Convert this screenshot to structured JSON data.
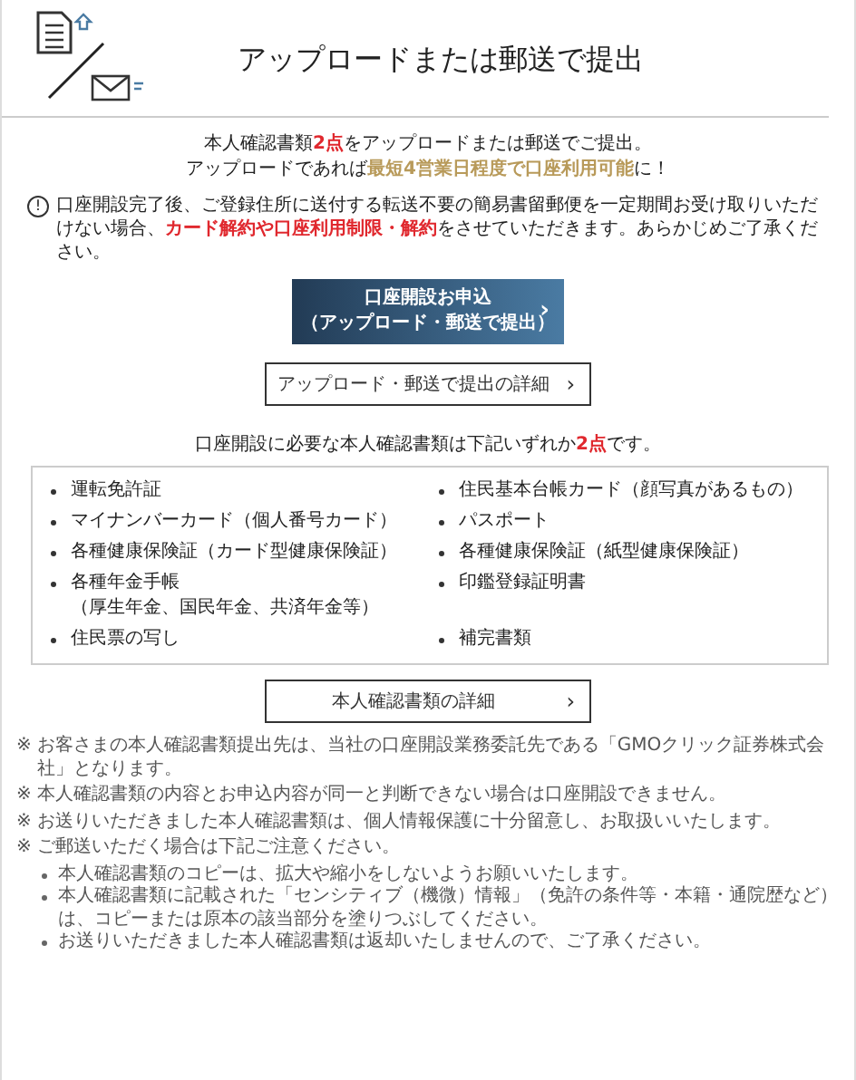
{
  "header": {
    "title": "アップロードまたは郵送で提出"
  },
  "intro": [
    [
      {
        "text": "本人確認書類",
        "kind": "plain"
      },
      {
        "text": "2点",
        "kind": "alert"
      },
      {
        "text": "をアップロードまたは郵送でご提出。",
        "kind": "plain"
      }
    ],
    [
      {
        "text": "アップロードであれば",
        "kind": "plain"
      },
      {
        "text": "最短4営業日程度で口座利用可能",
        "kind": "highlight"
      },
      {
        "text": "に！",
        "kind": "plain"
      }
    ]
  ],
  "warning": {
    "icon": "!",
    "segments": [
      {
        "text": "口座開設完了後、ご登録住所に送付する転送不要の簡易書留郵便を一定期間お受け取りいただけない場合、",
        "kind": "plain"
      },
      {
        "text": "カード解約や口座利用制限・解約",
        "kind": "alert"
      },
      {
        "text": "をさせていただきます。あらかじめご了承ください。",
        "kind": "plain"
      }
    ]
  },
  "apply_button": {
    "lines": [
      "口座開設お申込",
      "（アップロード・郵送で提出）"
    ],
    "chevron": "›"
  },
  "upload_detail_button": {
    "label": "アップロード・郵送で提出の詳細",
    "chevron": "›"
  },
  "documents_heading": [
    {
      "text": "口座開設に必要な本人確認書類は下記いずれか",
      "kind": "plain"
    },
    {
      "text": "2点",
      "kind": "alert"
    },
    {
      "text": "です。",
      "kind": "plain"
    }
  ],
  "documents": [
    {
      "lines": [
        "運転免許証"
      ]
    },
    {
      "lines": [
        "住民基本台帳カード（顔写真があるもの）"
      ]
    },
    {
      "lines": [
        "マイナンバーカード（個人番号カード）"
      ]
    },
    {
      "lines": [
        "パスポート"
      ]
    },
    {
      "lines": [
        "各種健康保険証（カード型健康保険証）"
      ]
    },
    {
      "lines": [
        "各種健康保険証（紙型健康保険証）"
      ]
    },
    {
      "lines": [
        "各種年金手帳",
        "（厚生年金、国民年金、共済年金等）"
      ]
    },
    {
      "lines": [
        "印鑑登録証明書"
      ]
    },
    {
      "lines": [
        "住民票の写し"
      ]
    },
    {
      "lines": [
        "補完書類"
      ]
    }
  ],
  "documents_detail_button": {
    "label": "本人確認書類の詳細",
    "chevron": "›"
  },
  "notes": [
    {
      "mark": "※",
      "text": "お客さまの本人確認書類提出先は、当社の口座開設業務委託先である「GMOクリック証券株式会社」となります。"
    },
    {
      "mark": "※",
      "text": "本人確認書類の内容とお申込内容が同一と判断できない場合は口座開設できません。"
    },
    {
      "mark": "※",
      "text": "お送りいただきました本人確認書類は、個人情報保護に十分留意し、お取扱いいたします。"
    },
    {
      "mark": "※",
      "text": "ご郵送いただく場合は下記ご注意ください。"
    }
  ],
  "mail_notes": [
    "本人確認書類のコピーは、拡大や縮小をしないようお願いいたします。",
    "本人確認書類に記載された「センシティブ（機微）情報」（免許の条件等・本籍・通院歴など）は、コピーまたは原本の該当部分を塗りつぶしてください。",
    "お送りいただきました本人確認書類は返却いたしませんので、ご了承ください。"
  ]
}
